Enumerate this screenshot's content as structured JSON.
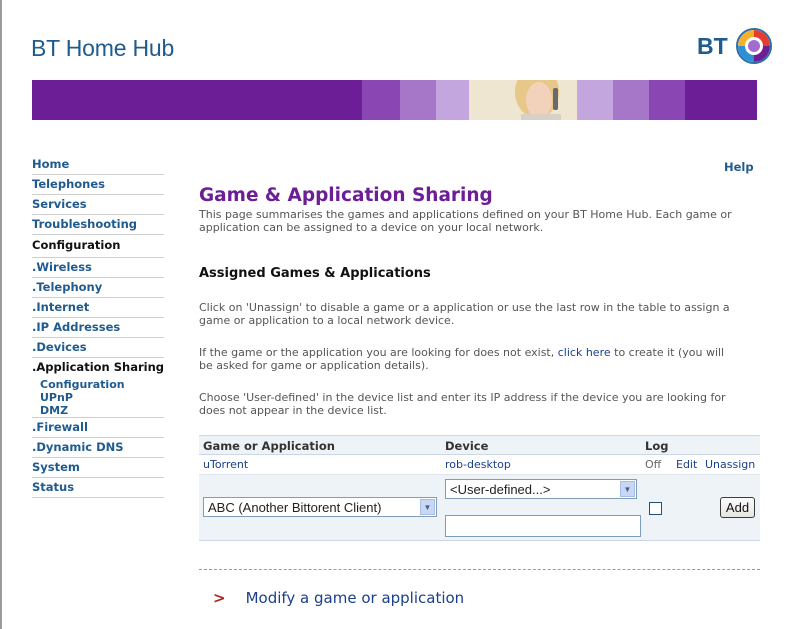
{
  "header": {
    "brand": "BT Home Hub",
    "logo_text": "BT"
  },
  "help_label": "Help",
  "nav": {
    "items": [
      {
        "label": "Home"
      },
      {
        "label": "Telephones"
      },
      {
        "label": "Services"
      },
      {
        "label": "Troubleshooting"
      },
      {
        "label": "Configuration"
      }
    ],
    "config_items": [
      {
        "label": ".Wireless"
      },
      {
        "label": ".Telephony"
      },
      {
        "label": ".Internet"
      },
      {
        "label": ".IP Addresses"
      },
      {
        "label": ".Devices"
      },
      {
        "label": ".Application Sharing"
      }
    ],
    "app_sharing_sub": [
      {
        "label": "Configuration"
      },
      {
        "label": "UPnP"
      },
      {
        "label": "DMZ"
      }
    ],
    "after_items": [
      {
        "label": ".Firewall"
      },
      {
        "label": ".Dynamic DNS"
      },
      {
        "label": "System"
      },
      {
        "label": "Status"
      }
    ]
  },
  "main": {
    "title": "Game & Application Sharing",
    "intro_1": "This page summarises the games and applications defined on your BT Home Hub. Each game or",
    "intro_2": "application can be assigned to a device on your local network.",
    "section_title": "Assigned Games & Applications",
    "para1_1": "Click on 'Unassign' to disable a game or a application or use the last row in the table to assign a",
    "para1_2": "game or application to a local network device.",
    "para2_pre": "If the game or the application you are looking for does not exist,",
    "para2_link": "click here",
    "para2_post": "to create it (you will",
    "para2_2": "be asked for game or application details).",
    "para3_1": "Choose 'User-defined' in the device list and enter its IP address if the device you are looking for",
    "para3_2": "does not appear in the device list."
  },
  "table": {
    "headers": {
      "app": "Game or Application",
      "device": "Device",
      "log": "Log"
    },
    "rows": [
      {
        "app": "uTorrent",
        "device": "rob-desktop",
        "log": "Off",
        "edit": "Edit",
        "unassign": "Unassign"
      }
    ],
    "new_row": {
      "app_select": "ABC (Another Bittorent Client)",
      "device_select": "<User-defined...>",
      "ip_value": "",
      "log_checked": false,
      "add_label": "Add"
    }
  },
  "modify_link": "Modify a game or application",
  "colors": {
    "purple": "#6b1e96",
    "blue": "#1f5b8f",
    "link": "#1a3f8c"
  }
}
